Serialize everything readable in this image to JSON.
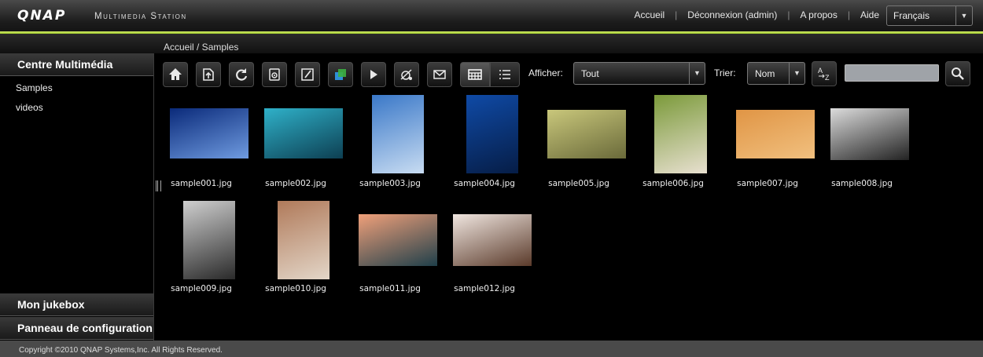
{
  "header": {
    "logo": "QNAP",
    "product": "Multimedia Station",
    "nav": [
      {
        "label": "Accueil"
      },
      {
        "label": "Déconnexion (admin)"
      },
      {
        "label": "A propos"
      },
      {
        "label": "Aide"
      }
    ],
    "language": "Français"
  },
  "breadcrumb": "Accueil / Samples",
  "sidebar": {
    "section_title": "Centre Multimédia",
    "items": [
      "Samples",
      "videos"
    ],
    "jukebox": "Mon jukebox",
    "config": "Panneau de configuration"
  },
  "toolbar": {
    "buttons": [
      "home-icon",
      "upload-icon",
      "refresh-icon",
      "settings-icon",
      "edit-icon",
      "publish-icon",
      "play-icon",
      "rss-icon",
      "email-icon",
      "grid-view-icon",
      "list-view-icon"
    ],
    "display_label": "Afficher:",
    "display_value": "Tout",
    "sort_label": "Trier:",
    "sort_value": "Nom",
    "sort_az": "A→Z",
    "search_value": ""
  },
  "files": [
    {
      "name": "sample001.jpg",
      "colors": [
        "#0a2a7a",
        "#6f9be0"
      ]
    },
    {
      "name": "sample002.jpg",
      "colors": [
        "#2fb1c9",
        "#0d3f52"
      ]
    },
    {
      "name": "sample003.jpg",
      "colors": [
        "#3a78c8",
        "#c8dcf2"
      ]
    },
    {
      "name": "sample004.jpg",
      "colors": [
        "#0f4aa6",
        "#061d46"
      ]
    },
    {
      "name": "sample005.jpg",
      "colors": [
        "#c9c77b",
        "#6a6a3a"
      ]
    },
    {
      "name": "sample006.jpg",
      "colors": [
        "#7b9a3a",
        "#e8e0d0"
      ]
    },
    {
      "name": "sample007.jpg",
      "colors": [
        "#e09545",
        "#f1c07f"
      ]
    },
    {
      "name": "sample008.jpg",
      "colors": [
        "#dcdcdc",
        "#222222"
      ]
    },
    {
      "name": "sample009.jpg",
      "colors": [
        "#cfcfcf",
        "#2a2a2a"
      ]
    },
    {
      "name": "sample010.jpg",
      "colors": [
        "#b07a5a",
        "#e3d6c8"
      ]
    },
    {
      "name": "sample011.jpg",
      "colors": [
        "#f0a07a",
        "#1f3f4a"
      ]
    },
    {
      "name": "sample012.jpg",
      "colors": [
        "#f0e6e0",
        "#5a3a2a"
      ]
    }
  ],
  "footer": "Copyright ©2010 QNAP Systems,Inc. All Rights Reserved.",
  "colors": {
    "accent_green": "#b5d84a",
    "background": "#000000"
  }
}
